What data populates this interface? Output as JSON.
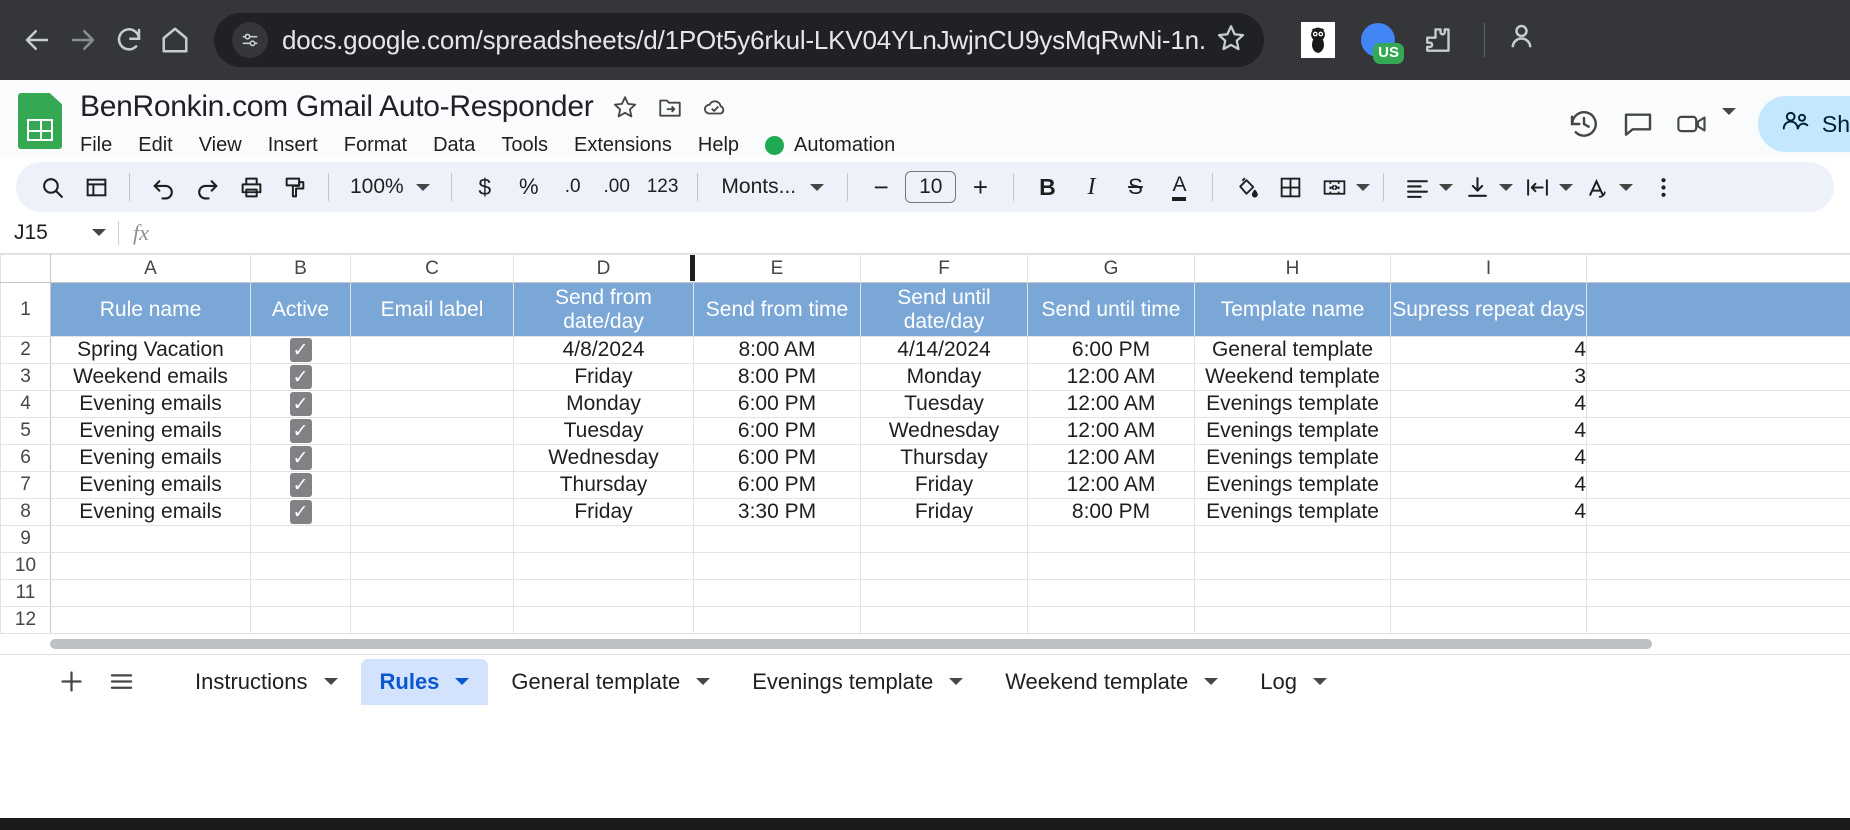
{
  "browser": {
    "back_icon": "back-arrow-icon",
    "forward_icon": "forward-arrow-icon",
    "reload_icon": "reload-icon",
    "home_icon": "home-icon",
    "site_info_icon": "site-settings-icon",
    "url": "docs.google.com/spreadsheets/d/1POt5y6rkul-LKV04YLnJwjnCU9ysMqRwNi-1n...",
    "bookmark_icon": "star-icon",
    "extensions": [
      {
        "name": "owl-extension-icon"
      },
      {
        "name": "profile-avatar-icon",
        "badge": "US"
      },
      {
        "name": "extensions-puzzle-icon"
      }
    ]
  },
  "sheets": {
    "logo_icon": "google-sheets-logo",
    "doc_title": "BenRonkin.com Gmail Auto-Responder",
    "title_icons": [
      "star-icon",
      "move-to-folder-icon",
      "drive-status-cloud-icon"
    ],
    "menus": [
      "File",
      "Edit",
      "View",
      "Insert",
      "Format",
      "Data",
      "Tools",
      "Extensions",
      "Help"
    ],
    "automation_menu": "Automation",
    "automation_dot_color": "#1eaa50",
    "header_right_icons": [
      "version-history-icon",
      "comment-icon",
      "meet-camera-icon"
    ],
    "share_label": "Sh",
    "share_icon": "people-share-icon",
    "share_bg": "#c2e7ff"
  },
  "toolbar": {
    "search_icon": "search-icon",
    "menus_icon": "all-menus-icon",
    "undo_icon": "undo-icon",
    "redo_icon": "redo-icon",
    "print_icon": "print-icon",
    "paint_format_icon": "paint-format-icon",
    "zoom_value": "100%",
    "currency_label": "$",
    "percent_label": "%",
    "decrease_decimal_label": ".0",
    "increase_decimal_label": ".00",
    "more_formats_label": "123",
    "font_name": "Monts...",
    "font_decrease": "−",
    "font_size": "10",
    "font_increase": "+",
    "bold_label": "B",
    "italic_label": "I",
    "strikethrough_label": "S",
    "text_color_label": "A",
    "fill_color_icon": "fill-color-icon",
    "borders_icon": "borders-icon",
    "merge_icon": "merge-cells-icon",
    "halign_icon": "horizontal-align-icon",
    "valign_icon": "vertical-align-icon",
    "text_wrap_icon": "text-wrapping-icon",
    "text_rotation_label": "A",
    "more_icon": "more-options-icon"
  },
  "formula_bar": {
    "name_box": "J15",
    "fx_label": "fx",
    "formula_value": ""
  },
  "grid": {
    "columns": [
      "A",
      "B",
      "C",
      "D",
      "E",
      "F",
      "G",
      "H",
      "I"
    ],
    "row_numbers": [
      "1",
      "2",
      "3",
      "4",
      "5",
      "6",
      "7",
      "8",
      "9",
      "10",
      "11",
      "12"
    ],
    "header_bg": "#7ba7d7",
    "headers": [
      "Rule name",
      "Active",
      "Email label",
      "Send from date/day",
      "Send from time",
      "Send until date/day",
      "Send until time",
      "Template name",
      "Supress repeat days"
    ],
    "rows": [
      {
        "rule_name": "Spring Vacation",
        "active": true,
        "email_label": "",
        "send_from_day": "4/8/2024",
        "send_from_time": "8:00 AM",
        "send_until_day": "4/14/2024",
        "send_until_time": "6:00 PM",
        "template_name": "General template",
        "suppress_days": "4"
      },
      {
        "rule_name": "Weekend emails",
        "active": true,
        "email_label": "",
        "send_from_day": "Friday",
        "send_from_time": "8:00 PM",
        "send_until_day": "Monday",
        "send_until_time": "12:00 AM",
        "template_name": "Weekend template",
        "suppress_days": "3"
      },
      {
        "rule_name": "Evening emails",
        "active": true,
        "email_label": "",
        "send_from_day": "Monday",
        "send_from_time": "6:00 PM",
        "send_until_day": "Tuesday",
        "send_until_time": "12:00 AM",
        "template_name": "Evenings template",
        "suppress_days": "4"
      },
      {
        "rule_name": "Evening emails",
        "active": true,
        "email_label": "",
        "send_from_day": "Tuesday",
        "send_from_time": "6:00 PM",
        "send_until_day": "Wednesday",
        "send_until_time": "12:00 AM",
        "template_name": "Evenings template",
        "suppress_days": "4"
      },
      {
        "rule_name": "Evening emails",
        "active": true,
        "email_label": "",
        "send_from_day": "Wednesday",
        "send_from_time": "6:00 PM",
        "send_until_day": "Thursday",
        "send_until_time": "12:00 AM",
        "template_name": "Evenings template",
        "suppress_days": "4"
      },
      {
        "rule_name": "Evening emails",
        "active": true,
        "email_label": "",
        "send_from_day": "Thursday",
        "send_from_time": "6:00 PM",
        "send_until_day": "Friday",
        "send_until_time": "12:00 AM",
        "template_name": "Evenings template",
        "suppress_days": "4"
      },
      {
        "rule_name": "Evening emails",
        "active": true,
        "email_label": "",
        "send_from_day": "Friday",
        "send_from_time": "3:30 PM",
        "send_until_day": "Friday",
        "send_until_time": "8:00 PM",
        "template_name": "Evenings template",
        "suppress_days": "4"
      }
    ],
    "checkbox_glyph": "✓"
  },
  "tabs": {
    "add_sheet_icon": "add-sheet-icon",
    "all_sheets_icon": "all-sheets-icon",
    "items": [
      {
        "label": "Instructions",
        "active": false
      },
      {
        "label": "Rules",
        "active": true
      },
      {
        "label": "General template",
        "active": false
      },
      {
        "label": "Evenings template",
        "active": false
      },
      {
        "label": "Weekend template",
        "active": false
      },
      {
        "label": "Log",
        "active": false
      }
    ]
  }
}
